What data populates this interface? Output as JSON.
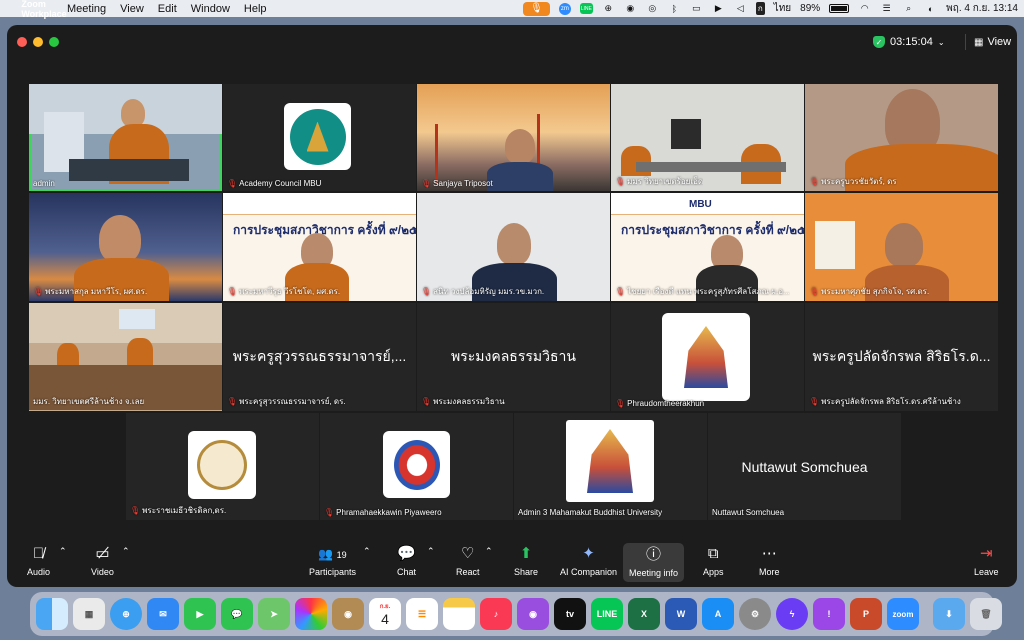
{
  "menubar": {
    "app_name": "Zoom Workplace",
    "items": [
      "Meeting",
      "View",
      "Edit",
      "Window",
      "Help"
    ],
    "keyboard": "ไทย",
    "battery": "89%",
    "datetime": "พฤ. 4 ก.ย.  13:14"
  },
  "window": {
    "timer": "03:15:04",
    "view_label": "View"
  },
  "tiles": [
    {
      "label": "admin"
    },
    {
      "label": "Academy Council MBU"
    },
    {
      "label": "Sanjaya Triposot"
    },
    {
      "label": "มมร วิทยาเขตร้อยเอ็ด"
    },
    {
      "label": "พระครูบวรชัยวัตร์, ดร"
    },
    {
      "label": "พระมหาสกุล มหาวีโร, ผศ.ดร."
    },
    {
      "label": "พระมหาวีรุธ วีรโชโต, ผศ.ดร."
    },
    {
      "label": "สนิท  วงปล้อมหิรัญ มมร.วข.มวก."
    },
    {
      "label": "ไชยยา  เรืองดี  แทน  พระครูสุภัทรศีลโสภณ ผ.อ..."
    },
    {
      "label": "พระมหาศุภชัย สุภกิจโจ, รศ.ดร."
    },
    {
      "label": "มมร. วิทยาเขตศรีล้านช้าง จ.เลย"
    },
    {
      "label": "พระครูสุวรรณธรรมาจารย์, ดร.",
      "big": "พระครูสุวรรณธรรมาจารย์,..."
    },
    {
      "label": "พระมงคลธรรมวิธาน",
      "big": "พระมงคลธรรมวิธาน"
    },
    {
      "label": "Phraudomtheerakhun"
    },
    {
      "label": "พระครูปลัดจักรพล สิริธโร.ดร.ศรีล้านช้าง",
      "big": "พระครูปลัดจักรพล สิริธโร.ด..."
    },
    {
      "label": "พระราชเมธีวชิรดิลก,ดร."
    },
    {
      "label": "Phramahaekkawin Piyaweero"
    },
    {
      "label": "Admin 3 Mahamakut Buddhist University"
    },
    {
      "label": "Nuttawut Somchuea",
      "big": "Nuttawut Somchuea"
    }
  ],
  "slides": {
    "header": "MBU",
    "title": "การประชุมสภาวิชาการ ครั้งที่ ๙/๒๕๖๘"
  },
  "toolbar": {
    "audio": "Audio",
    "video": "Video",
    "participants": "Participants",
    "participants_count": "19",
    "chat": "Chat",
    "react": "React",
    "share": "Share",
    "ai_companion": "AI Companion",
    "meeting_info": "Meeting info",
    "apps": "Apps",
    "more": "More",
    "leave": "Leave"
  },
  "dock": {
    "calendar_month": "ก.ย.",
    "calendar_day": "4",
    "apps": [
      "finder",
      "launchpad",
      "safari",
      "mail",
      "facetime",
      "messages",
      "maps",
      "photos",
      "contacts",
      "calendar",
      "reminders",
      "notes",
      "music",
      "podcasts",
      "tv",
      "line",
      "excel",
      "word",
      "app-store",
      "system-settings",
      "messenger",
      "feedback",
      "powerpoint",
      "zoom",
      "downloads",
      "trash"
    ]
  },
  "colors": {
    "active_speaker": "#3ad55a",
    "muted": "#ff3b30",
    "share_green": "#29c361",
    "mic_indicator": "#f0871f"
  }
}
